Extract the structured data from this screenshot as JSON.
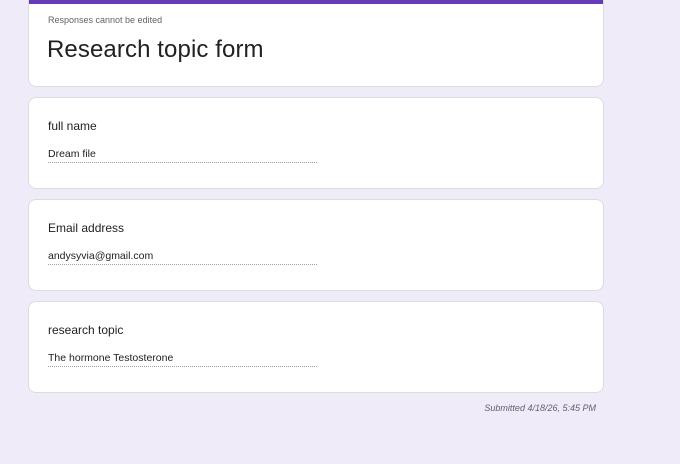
{
  "form": {
    "notice": "Responses cannot be edited",
    "title": "Research topic form",
    "accent_color": "#673ab7",
    "background_color": "#f0ebf8"
  },
  "questions": [
    {
      "label": "full name",
      "answer": "Dream file"
    },
    {
      "label": "Email address",
      "answer": "andysyvia@gmail.com"
    },
    {
      "label": "research topic",
      "answer": "The hormone Testosterone"
    }
  ],
  "footer": {
    "submitted": "Submitted 4/18/26, 5:45 PM"
  }
}
